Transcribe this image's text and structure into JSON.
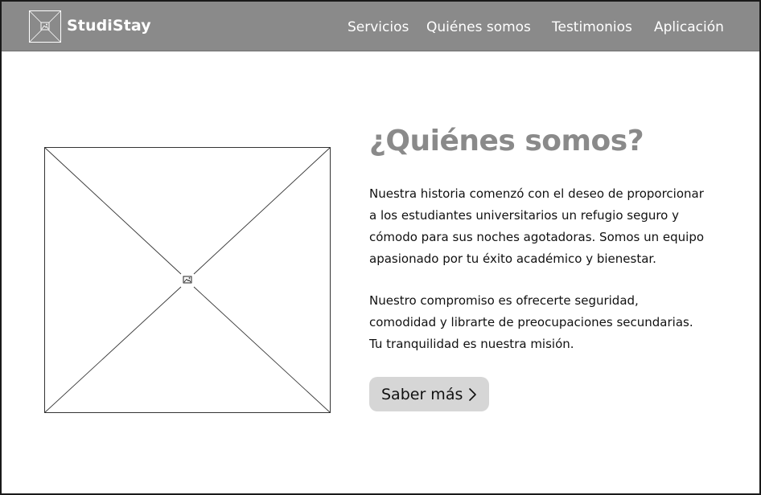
{
  "navbar": {
    "brand": "StudiStay",
    "logo_icon": "image-placeholder-icon",
    "links": [
      {
        "label": "Servicios"
      },
      {
        "label": "Quiénes somos"
      },
      {
        "label": "Testimonios"
      },
      {
        "label": "Aplicación"
      }
    ]
  },
  "about": {
    "image_icon": "image-placeholder-icon",
    "heading": "¿Quiénes somos?",
    "paragraph1_lines": [
      "Nuestra historia comenzó con el deseo de proporcionar",
      "a los estudiantes universitarios un refugio seguro y",
      "cómodo para sus noches agotadoras. Somos un equipo",
      "apasionado por tu éxito académico y bienestar."
    ],
    "paragraph2_lines": [
      "Nuestro compromiso es ofrecerte seguridad,",
      "comodidad y librarte de preocupaciones secundarias.",
      "Tu tranquilidad es nuestra misión."
    ],
    "cta_label": "Saber más",
    "cta_icon": "chevron-right-icon"
  },
  "colors": {
    "navbar_bg": "#8a8a8a",
    "heading": "#8a8a8a",
    "button_bg": "#d6d6d6",
    "text": "#111111"
  }
}
